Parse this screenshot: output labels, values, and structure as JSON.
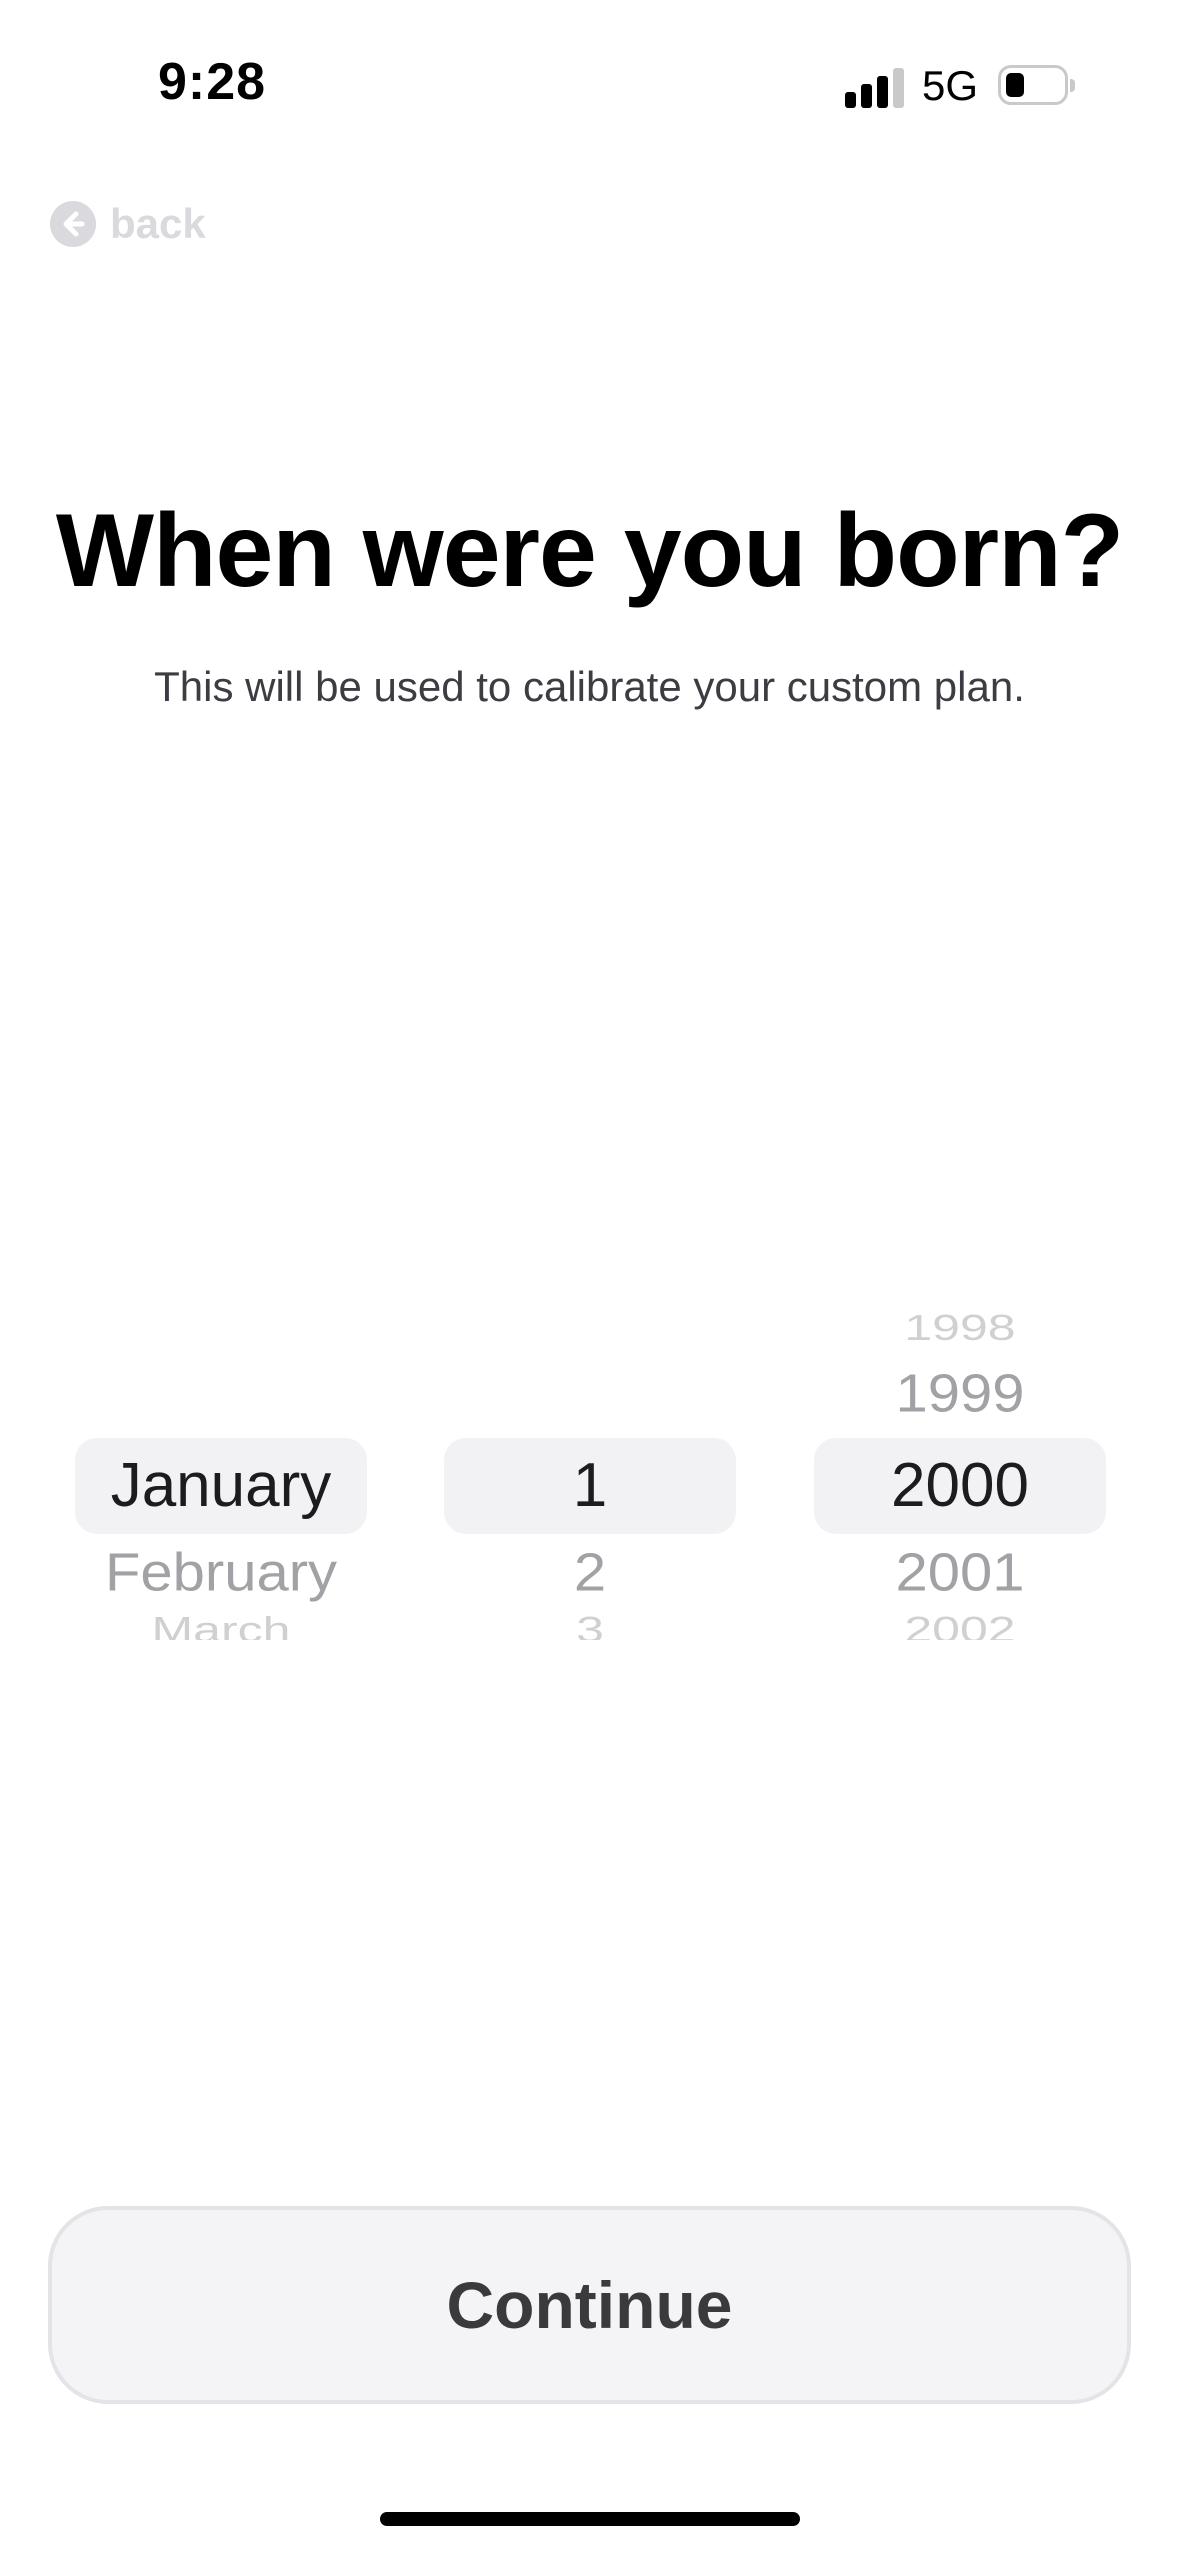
{
  "status_bar": {
    "time": "9:28",
    "network": "5G"
  },
  "nav": {
    "back_label": "back"
  },
  "header": {
    "title": "When were you born?",
    "subtitle": "This will be used to calibrate your custom plan."
  },
  "picker": {
    "month": {
      "selected": "January",
      "next_1": "February",
      "next_2": "March"
    },
    "day": {
      "selected": "1",
      "next_1": "2",
      "next_2": "3"
    },
    "year": {
      "prev_2": "1998",
      "prev_1": "1999",
      "selected": "2000",
      "next_1": "2001",
      "next_2": "2002"
    }
  },
  "footer": {
    "continue_label": "Continue"
  }
}
